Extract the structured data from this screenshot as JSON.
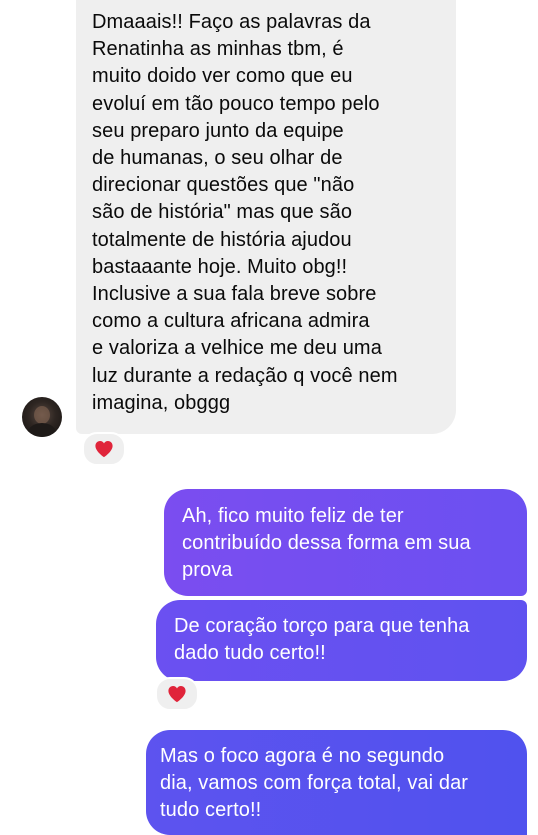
{
  "conversation": {
    "messages": [
      {
        "direction": "incoming",
        "text": "Dmaaais!! Faço as palavras da\nRenatinha as minhas tbm, é\nmuito doido ver como que eu\nevoluí em tão pouco tempo pelo\nseu preparo junto da equipe\nde humanas, o seu olhar de\ndirecionar questões que \"não\nsão de história\" mas que são\ntotalmente de história ajudou\nbastaaante hoje. Muito obg!!\nInclusive a sua fala breve sobre\ncomo a cultura africana admira\ne valoriza a velhice me deu uma\nluz durante a redação q você nem\nimagina, obggg",
        "reaction": "heart-icon"
      },
      {
        "direction": "outgoing",
        "text": "Ah, fico muito feliz de ter\ncontribuído dessa forma em sua\nprova"
      },
      {
        "direction": "outgoing",
        "text": "De coração torço para que tenha\ndado tudo certo!!",
        "reaction": "heart-icon"
      },
      {
        "direction": "outgoing",
        "text": "Mas o foco agora é no segundo\ndia, vamos com força total, vai dar\ntudo certo!!"
      }
    ]
  },
  "colors": {
    "incoming_bubble": "#efefef",
    "outgoing_gradient_start": "#7b4df0",
    "outgoing_gradient_end": "#5052ee",
    "reaction_heart": "#e0243a"
  }
}
